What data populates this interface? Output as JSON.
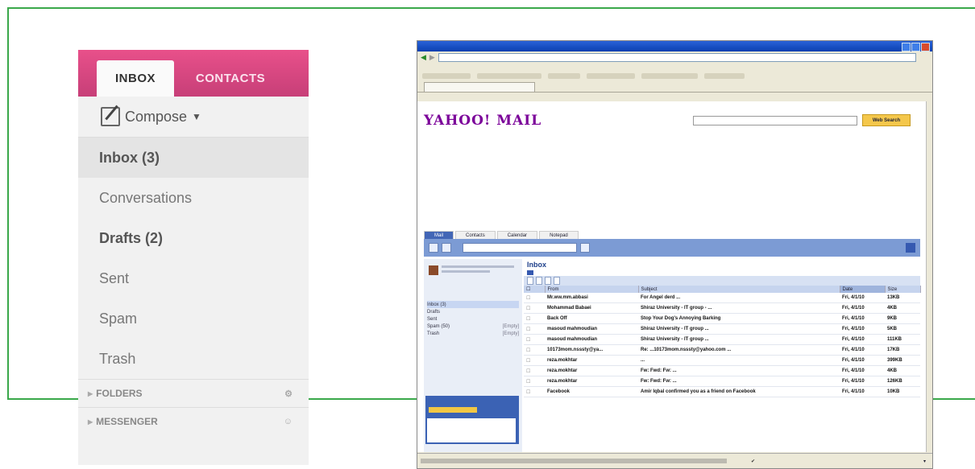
{
  "left_panel": {
    "tabs": [
      {
        "label": "INBOX"
      },
      {
        "label": "CONTACTS"
      }
    ],
    "compose_label": "Compose",
    "nav": [
      {
        "label": "Inbox (3)",
        "bold": true
      },
      {
        "label": "Conversations",
        "bold": false
      },
      {
        "label": "Drafts (2)",
        "bold": true
      },
      {
        "label": "Sent",
        "bold": false
      },
      {
        "label": "Spam",
        "bold": false
      },
      {
        "label": "Trash",
        "bold": false
      }
    ],
    "sections": [
      {
        "label": "FOLDERS"
      },
      {
        "label": "MESSENGER"
      }
    ]
  },
  "browser": {
    "logo": "YAHOO! MAIL",
    "search_button": "Web Search",
    "nav_tabs": [
      "Mail",
      "Contacts",
      "Calendar",
      "Notepad"
    ],
    "inbox_title": "Inbox",
    "folders": [
      {
        "label": "Inbox (3)",
        "count": ""
      },
      {
        "label": "Drafts",
        "count": ""
      },
      {
        "label": "Sent",
        "count": ""
      },
      {
        "label": "Spam (50)",
        "count": "[Empty]"
      },
      {
        "label": "Trash",
        "count": "[Empty]"
      }
    ],
    "columns": [
      "From",
      "Subject",
      "Date",
      "Size"
    ],
    "messages": [
      {
        "from": "Mr.ww.mm.abbasi",
        "subject": "For Angel derd ...",
        "date": "Fri, 4/1/10",
        "size": "13KB"
      },
      {
        "from": "Mohammad Babaei",
        "subject": "Shiraz University - IT group - ...",
        "date": "Fri, 4/1/10",
        "size": "4KB"
      },
      {
        "from": "Back Off",
        "subject": "Stop Your Dog's Annoying Barking",
        "date": "Fri, 4/1/10",
        "size": "9KB"
      },
      {
        "from": "masoud mahmoudian",
        "subject": "Shiraz University - IT group ...",
        "date": "Fri, 4/1/10",
        "size": "5KB"
      },
      {
        "from": "masoud mahmoudian",
        "subject": "Shiraz University - IT group ...",
        "date": "Fri, 4/1/10",
        "size": "111KB"
      },
      {
        "from": "10173mom.nsssty@ya...",
        "subject": "Re: ...10173mom.nsssty@yahoo.com ...",
        "date": "Fri, 4/1/10",
        "size": "17KB"
      },
      {
        "from": "reza.mokhtar",
        "subject": "...",
        "date": "Fri, 4/1/10",
        "size": "399KB"
      },
      {
        "from": "reza.mokhtar",
        "subject": "Fw: Fwd: Fw: ...",
        "date": "Fri, 4/1/10",
        "size": "4KB"
      },
      {
        "from": "reza.mokhtar",
        "subject": "Fw: Fwd: Fw: ...",
        "date": "Fri, 4/1/10",
        "size": "126KB"
      },
      {
        "from": "Facebook",
        "subject": "Amir Iqbal confirmed you as a friend on Facebook",
        "date": "Fri, 4/1/10",
        "size": "10KB"
      }
    ]
  }
}
